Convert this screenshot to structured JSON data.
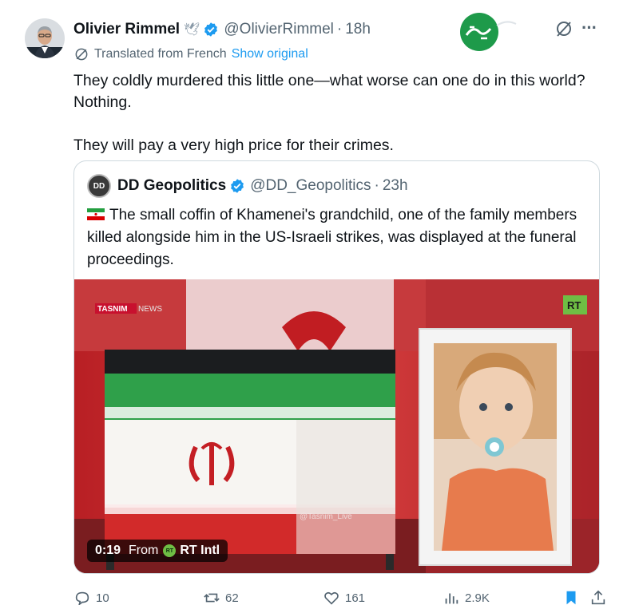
{
  "author": {
    "name": "Olivier Rimmel",
    "handle": "@OlivierRimmel",
    "time": "18h",
    "separator": "·"
  },
  "translation": {
    "label": "Translated from French",
    "show_original": "Show original"
  },
  "post": {
    "line1": "They coldly murdered this little one—what worse can one do in this world? Nothing.",
    "line2": "They will pay a very high price for their crimes."
  },
  "quote": {
    "avatar_text": "DD",
    "name": "DD Geopolitics",
    "handle": "@DD_Geopolitics",
    "time": "23h",
    "text": "The small coffin of Khamenei's grandchild, one of the family members killed alongside him in the US-Israeli strikes, was displayed at the funeral proceedings.",
    "media": {
      "watermark_left": "TASNIM",
      "watermark_left_suffix": "NEWS",
      "watermark_right": "RT",
      "bottom_watermark": "@Tasnim_Live",
      "duration": "0:19",
      "from_label": "From",
      "source": "RT Intl"
    }
  },
  "actions": {
    "replies": "10",
    "reposts": "62",
    "likes": "161",
    "views": "2.9K"
  },
  "colors": {
    "accent": "#1d9bf0",
    "secondary_text": "#536471",
    "verified": "#1d9bf0",
    "bookmark": "#1d9bf0",
    "brand_logo": "#1e9a4a"
  }
}
